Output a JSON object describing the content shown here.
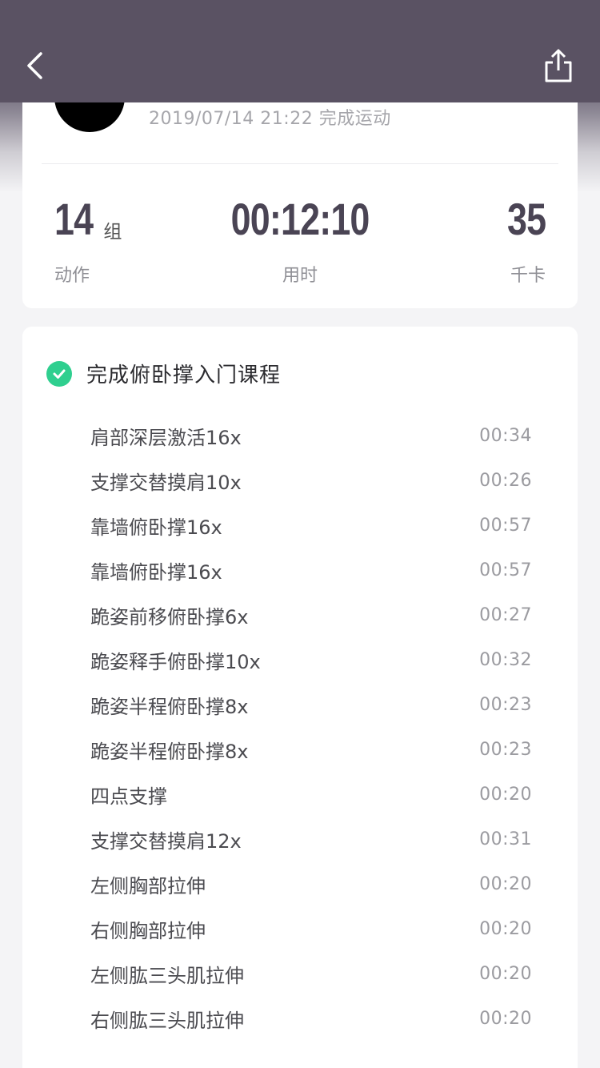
{
  "header": {
    "back_icon": "chevron-left-icon",
    "share_icon": "share-icon"
  },
  "summary": {
    "completed_at": "2019/07/14 21:22 完成运动",
    "stats": {
      "actions": {
        "value": "14",
        "unit": "组",
        "label": "动作"
      },
      "duration": {
        "value": "00:12:10",
        "label": "用时"
      },
      "calories": {
        "value": "35",
        "label": "千卡"
      }
    }
  },
  "course": {
    "title": "完成俯卧撑入门课程",
    "status_color": "#2fcf8f",
    "exercises": [
      {
        "name": "肩部深层激活16x",
        "time": "00:34"
      },
      {
        "name": "支撑交替摸肩10x",
        "time": "00:26"
      },
      {
        "name": "靠墙俯卧撑16x",
        "time": "00:57"
      },
      {
        "name": "靠墙俯卧撑16x",
        "time": "00:57"
      },
      {
        "name": "跪姿前移俯卧撑6x",
        "time": "00:27"
      },
      {
        "name": "跪姿释手俯卧撑10x",
        "time": "00:32"
      },
      {
        "name": "跪姿半程俯卧撑8x",
        "time": "00:23"
      },
      {
        "name": "跪姿半程俯卧撑8x",
        "time": "00:23"
      },
      {
        "name": "四点支撑",
        "time": "00:20"
      },
      {
        "name": "支撑交替摸肩12x",
        "time": "00:31"
      },
      {
        "name": "左侧胸部拉伸",
        "time": "00:20"
      },
      {
        "name": "右侧胸部拉伸",
        "time": "00:20"
      },
      {
        "name": "左侧肱三头肌拉伸",
        "time": "00:20"
      },
      {
        "name": "右侧肱三头肌拉伸",
        "time": "00:20"
      }
    ]
  },
  "theme": {
    "header_bg": "#5a5263",
    "stat_color": "#4a4454"
  }
}
